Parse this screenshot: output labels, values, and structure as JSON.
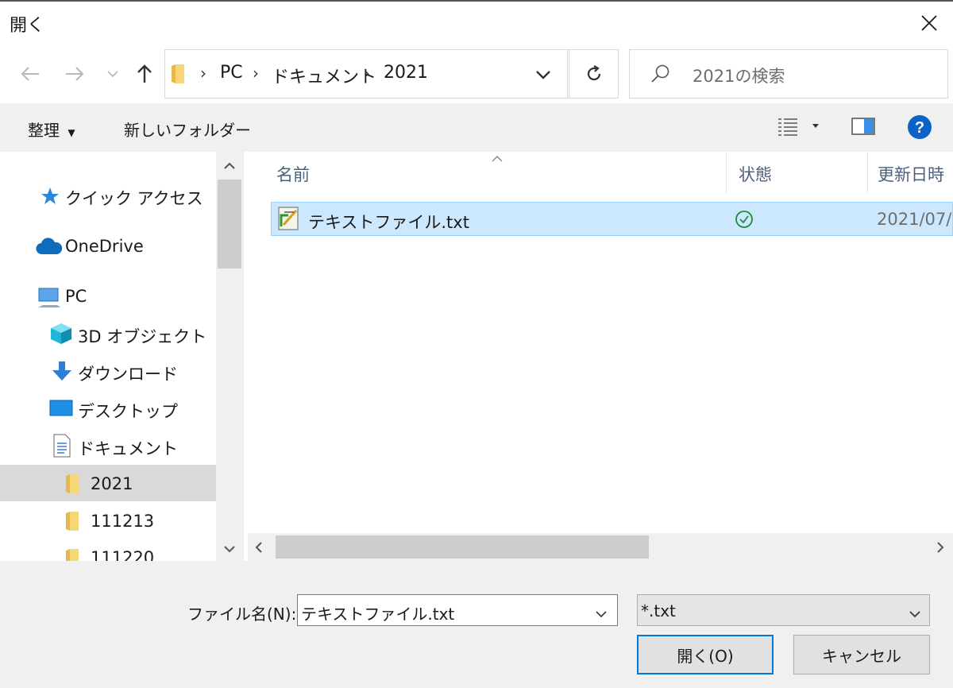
{
  "window": {
    "title": "開く"
  },
  "address": {
    "crumbs": [
      "PC",
      "ドキュメント",
      "2021"
    ]
  },
  "search": {
    "placeholder": "2021の検索"
  },
  "toolbar": {
    "organize": "整理",
    "new_folder": "新しいフォルダー"
  },
  "nav": {
    "quick_access": "クイック アクセス",
    "onedrive": "OneDrive",
    "pc": "PC",
    "objects3d": "3D オブジェクト",
    "downloads": "ダウンロード",
    "desktop": "デスクトップ",
    "documents": "ドキュメント",
    "folders": [
      "2021",
      "111213",
      "111220"
    ]
  },
  "list": {
    "columns": {
      "name": "名前",
      "status": "状態",
      "modified": "更新日時"
    },
    "rows": [
      {
        "name": "テキストファイル.txt",
        "modified": "2021/07/"
      }
    ]
  },
  "footer": {
    "filename_label": "ファイル名(N):",
    "filename_value": "テキストファイル.txt",
    "filter_value": "*.txt",
    "open_label": "開く(O)",
    "cancel_label": "キャンセル"
  },
  "colors": {
    "accent": "#0078d7",
    "selection": "#cce8ff",
    "help": "#0a64c8",
    "status_ok": "#1e8c3a"
  }
}
